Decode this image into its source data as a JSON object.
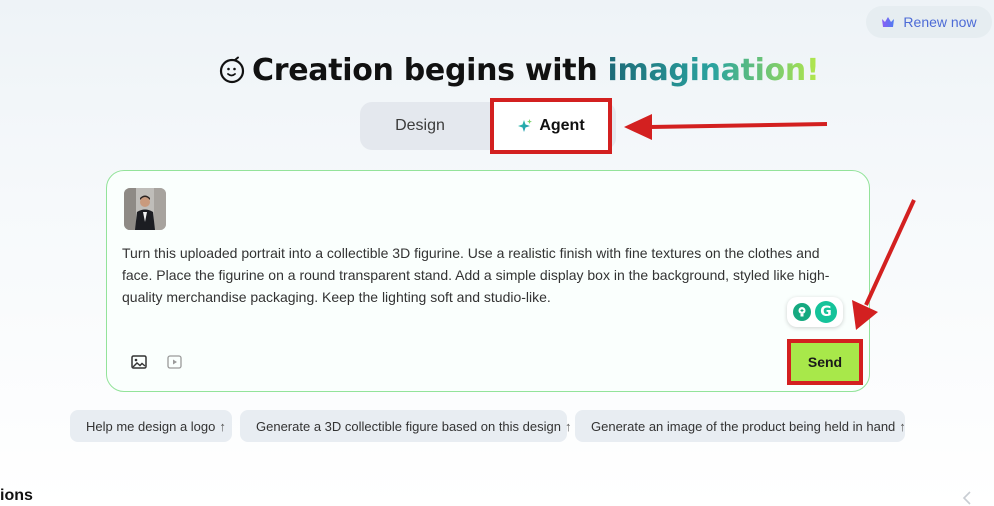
{
  "header": {
    "renew_label": "Renew now",
    "title_prefix": "Creation begins with ",
    "title_highlight": "imagination!"
  },
  "tabs": [
    {
      "label": "Design",
      "active": false
    },
    {
      "label": "Agent",
      "active": true
    }
  ],
  "composer": {
    "prompt": "Turn this uploaded portrait into a collectible 3D figurine. Use a realistic finish with fine textures on the clothes and face. Place the figurine on a round transparent stand. Add a simple display box in the background, styled like high-quality merchandise packaging. Keep the lighting soft and studio-like.",
    "send_label": "Send"
  },
  "suggestions": [
    {
      "label": "Help me design a logo",
      "arrow": "↑"
    },
    {
      "label": "Generate a 3D collectible figure based on this design",
      "arrow": "↑"
    },
    {
      "label": "Generate an image of the product being held in hand",
      "arrow": "↑"
    }
  ],
  "footer": {
    "section_fragment": "ions"
  },
  "colors": {
    "accent_green": "#a8e84a",
    "annotation_red": "#d32020",
    "renew_blue": "#4d6bd6"
  }
}
